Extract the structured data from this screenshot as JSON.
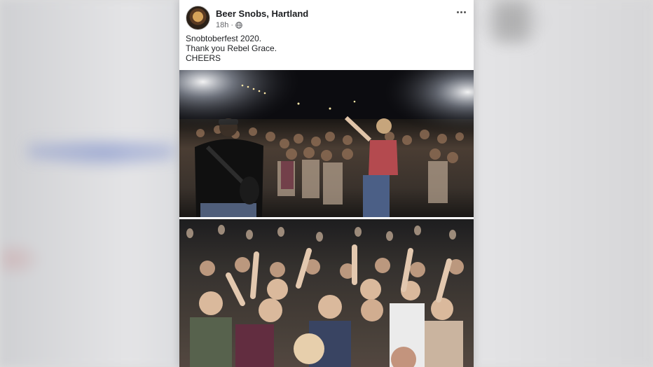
{
  "post": {
    "page_name": "Beer Snobs, Hartland",
    "time": "18h",
    "privacy_icon": "globe-icon",
    "more_icon": "more-dots-icon",
    "caption": [
      "Snobtoberfest 2020.",
      "Thank you Rebel Grace.",
      "CHEERS"
    ]
  },
  "photos": [
    {
      "name": "band-on-stage-photo"
    },
    {
      "name": "crowd-selfie-photo"
    }
  ],
  "colors": {
    "card_background": "#ffffff",
    "page_name_text": "#1c1e21",
    "meta_text": "#65676b",
    "background": "#dcdcdc"
  }
}
